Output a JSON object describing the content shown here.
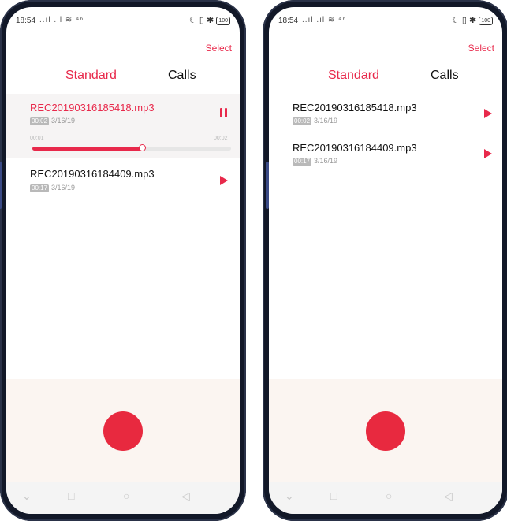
{
  "screens": [
    {
      "status": {
        "time": "18:54",
        "signal": "..ıl .ıl ≋ ⁴⁶",
        "icons_right": "☾ ▯ ✱",
        "battery": "100"
      },
      "select_label": "Select",
      "tabs": {
        "standard": "Standard",
        "calls": "Calls"
      },
      "recordings": [
        {
          "name": "REC20190316185418.mp3",
          "duration": "00:02",
          "date": "3/16/19",
          "state": "playing",
          "icon": "pause-icon"
        },
        {
          "name": "REC20190316184409.mp3",
          "duration": "00:17",
          "date": "3/16/19",
          "state": "idle",
          "icon": "play-icon"
        }
      ],
      "player": {
        "elapsed": "00:01",
        "total": "00:02",
        "progress": 0.55
      }
    },
    {
      "status": {
        "time": "18:54",
        "signal": "..ıl .ıl ≋ ⁴⁶",
        "icons_right": "☾ ▯ ✱",
        "battery": "100"
      },
      "select_label": "Select",
      "tabs": {
        "standard": "Standard",
        "calls": "Calls"
      },
      "recordings": [
        {
          "name": "REC20190316185418.mp3",
          "duration": "00:02",
          "date": "3/16/19",
          "state": "idle",
          "icon": "play-icon"
        },
        {
          "name": "REC20190316184409.mp3",
          "duration": "00:17",
          "date": "3/16/19",
          "state": "idle",
          "icon": "play-icon"
        }
      ]
    }
  ],
  "nav": {
    "down": "⌄",
    "recents": "□",
    "home": "○",
    "back": "◁"
  },
  "colors": {
    "accent": "#e8294b",
    "record": "#e8293f",
    "bottom_panel": "#fbf5f1"
  }
}
